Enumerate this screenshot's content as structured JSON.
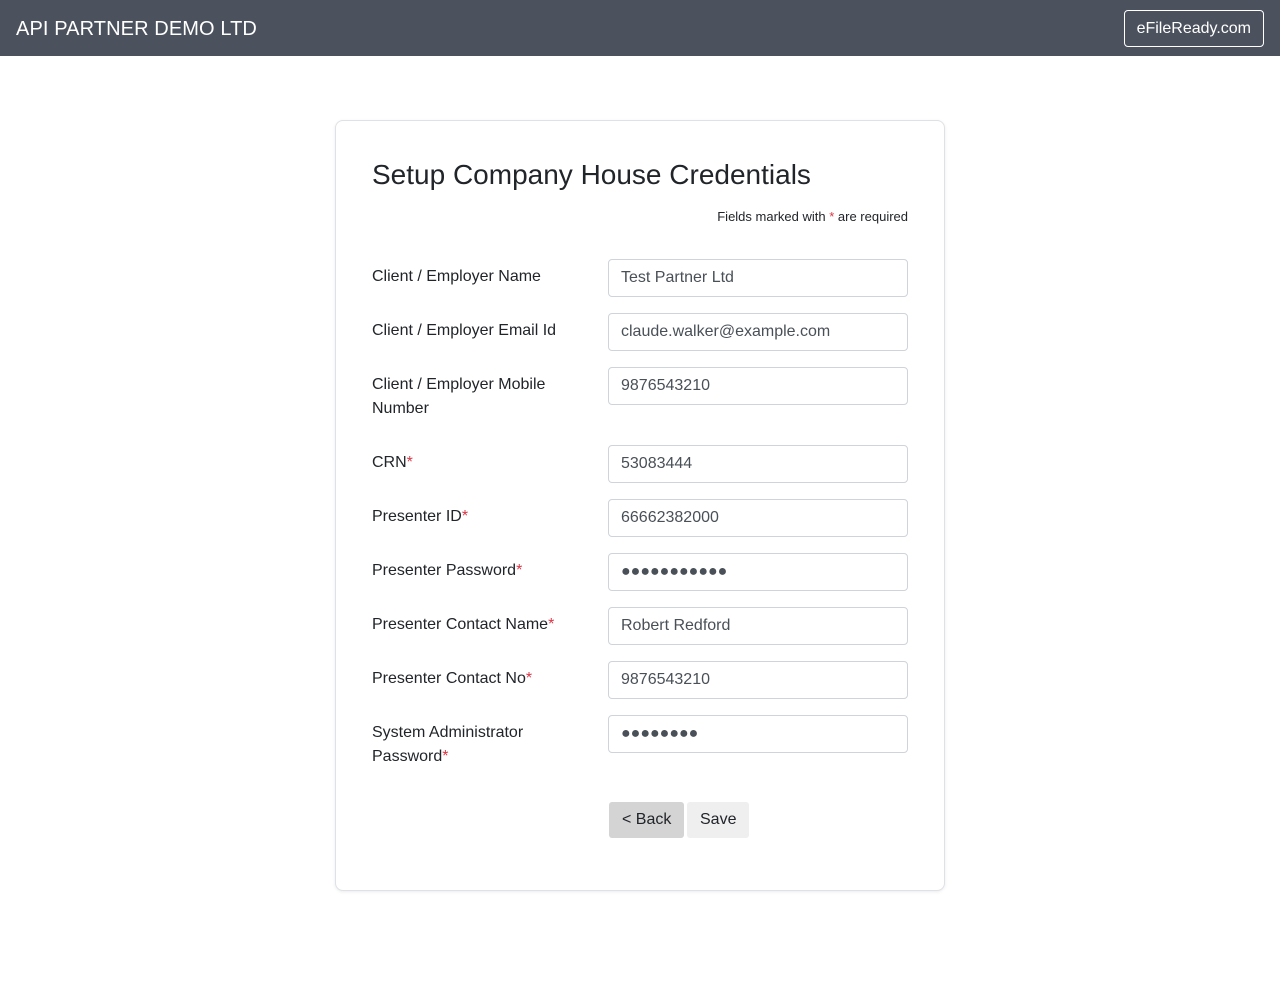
{
  "navbar": {
    "brand": "API PARTNER DEMO LTD",
    "site_link": "eFileReady.com"
  },
  "form": {
    "title": "Setup Company House Credentials",
    "required_note_prefix": "Fields marked with ",
    "required_marker": "*",
    "required_note_suffix": " are required",
    "fields": [
      {
        "label": "Client / Employer Name",
        "value": "Test Partner Ltd",
        "required": false
      },
      {
        "label": "Client / Employer Email Id",
        "value": "claude.walker@example.com",
        "required": false
      },
      {
        "label": "Client / Employer Mobile Number",
        "value": "9876543210",
        "required": false
      },
      {
        "label": "CRN",
        "value": "53083444",
        "required": true
      },
      {
        "label": "Presenter ID",
        "value": "66662382000",
        "required": true
      },
      {
        "label": "Presenter Password",
        "value": "●●●●●●●●●●●",
        "required": true
      },
      {
        "label": "Presenter Contact Name",
        "value": "Robert Redford",
        "required": true
      },
      {
        "label": "Presenter Contact No",
        "value": "9876543210",
        "required": true
      },
      {
        "label": "System Administrator Password",
        "value": "●●●●●●●●",
        "required": true
      }
    ],
    "back_label": "< Back",
    "save_label": "Save"
  },
  "colors": {
    "navbar_bg": "#4b525d",
    "required_marker": "#dc3545",
    "back_button_bg": "#d4d4d4",
    "save_button_bg": "#efefef"
  }
}
